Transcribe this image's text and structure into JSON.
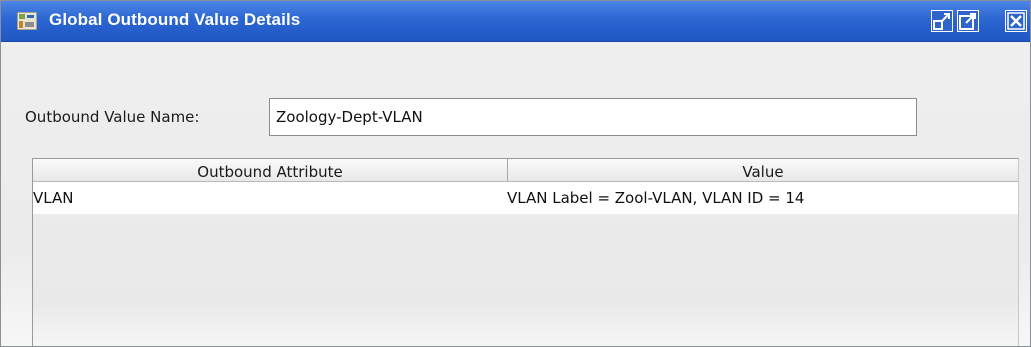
{
  "window": {
    "title": "Global Outbound Value Details",
    "app_icon": "app-icon",
    "titlebar_buttons": [
      "restore-icon",
      "maximize-icon",
      "close-icon"
    ]
  },
  "form": {
    "name_label": "Outbound Value Name:",
    "name_value": "Zoology-Dept-VLAN"
  },
  "table": {
    "columns": [
      "Outbound Attribute",
      "Value"
    ],
    "rows": [
      {
        "attribute": "VLAN",
        "value": "VLAN Label = Zool-VLAN, VLAN ID = 14"
      }
    ]
  },
  "colors": {
    "titlebar": "#2c66d2",
    "title_text": "#ffffff",
    "background": "#ededed"
  }
}
